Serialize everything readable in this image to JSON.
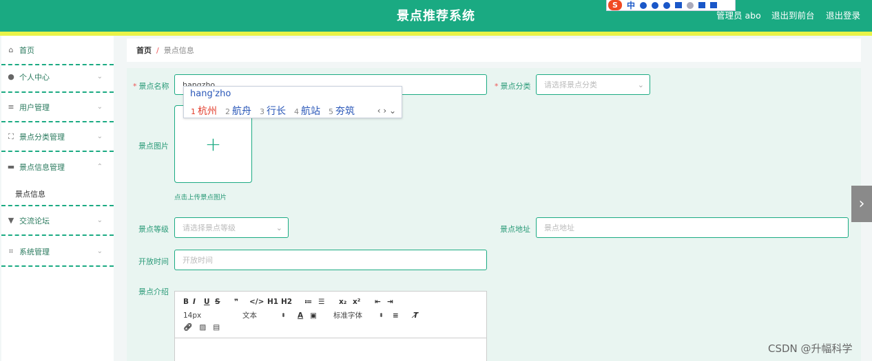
{
  "header": {
    "title": "景点推荐系统",
    "admin_label": "管理员 abo",
    "front_label": "退出到前台",
    "logout_label": "退出登录"
  },
  "ime_toolbar": {
    "logo": "S",
    "mode": "中",
    "icons": [
      "punctuation-icon",
      "emoji-icon",
      "mic-icon",
      "keyboard-icon",
      "user-icon",
      "skin-icon",
      "toolbox-icon"
    ]
  },
  "sidebar": {
    "items": [
      {
        "label": "首页",
        "icon": "home-icon"
      },
      {
        "label": "个人中心",
        "icon": "user-icon",
        "chevron": "⌄"
      },
      {
        "label": "用户管理",
        "icon": "list-icon",
        "chevron": "⌄"
      },
      {
        "label": "景点分类管理",
        "icon": "frame-icon",
        "chevron": "⌄"
      },
      {
        "label": "景点信息管理",
        "icon": "monitor-icon",
        "chevron": "⌃"
      },
      {
        "label": "交流论坛",
        "icon": "pin-icon",
        "chevron": "⌄"
      },
      {
        "label": "系统管理",
        "icon": "crop-icon",
        "chevron": "⌄"
      }
    ],
    "sub_item": "景点信息"
  },
  "breadcrumb": {
    "home": "首页",
    "separator": "/",
    "current": "景点信息"
  },
  "form": {
    "name_label": "景点名称",
    "name_value": "hangzho",
    "category_label": "景点分类",
    "category_placeholder": "请选择景点分类",
    "image_label": "景点图片",
    "upload_plus": "+",
    "upload_hint": "点击上传景点图片",
    "level_label": "景点等级",
    "level_placeholder": "请选择景点等级",
    "address_label": "景点地址",
    "address_placeholder": "景点地址",
    "open_time_label": "开放时间",
    "open_time_placeholder": "开放时间",
    "intro_label": "景点介绍"
  },
  "ime_popup": {
    "pinyin": "hang'zho",
    "candidates": [
      {
        "num": "1",
        "text": "杭州"
      },
      {
        "num": "2",
        "text": "航舟"
      },
      {
        "num": "3",
        "text": "行长"
      },
      {
        "num": "4",
        "text": "航站"
      },
      {
        "num": "5",
        "text": "夯筑"
      }
    ],
    "nav": "‹ › ⌄"
  },
  "editor": {
    "row1": [
      "B",
      "I",
      "U",
      "S",
      "❞",
      "</>",
      "H1",
      "H2",
      "≔",
      "☰",
      "x₂",
      "x²",
      "⇤",
      "⇥"
    ],
    "font_size": "14px",
    "text_style": "文本",
    "font_family": "标准字体",
    "row3": [
      "link-icon",
      "image-icon",
      "video-icon"
    ]
  },
  "watermark": "CSDN @升幅科学",
  "colors": {
    "primary": "#1aaa82",
    "strip": "#e9f348",
    "panel": "#e9f5f1"
  }
}
